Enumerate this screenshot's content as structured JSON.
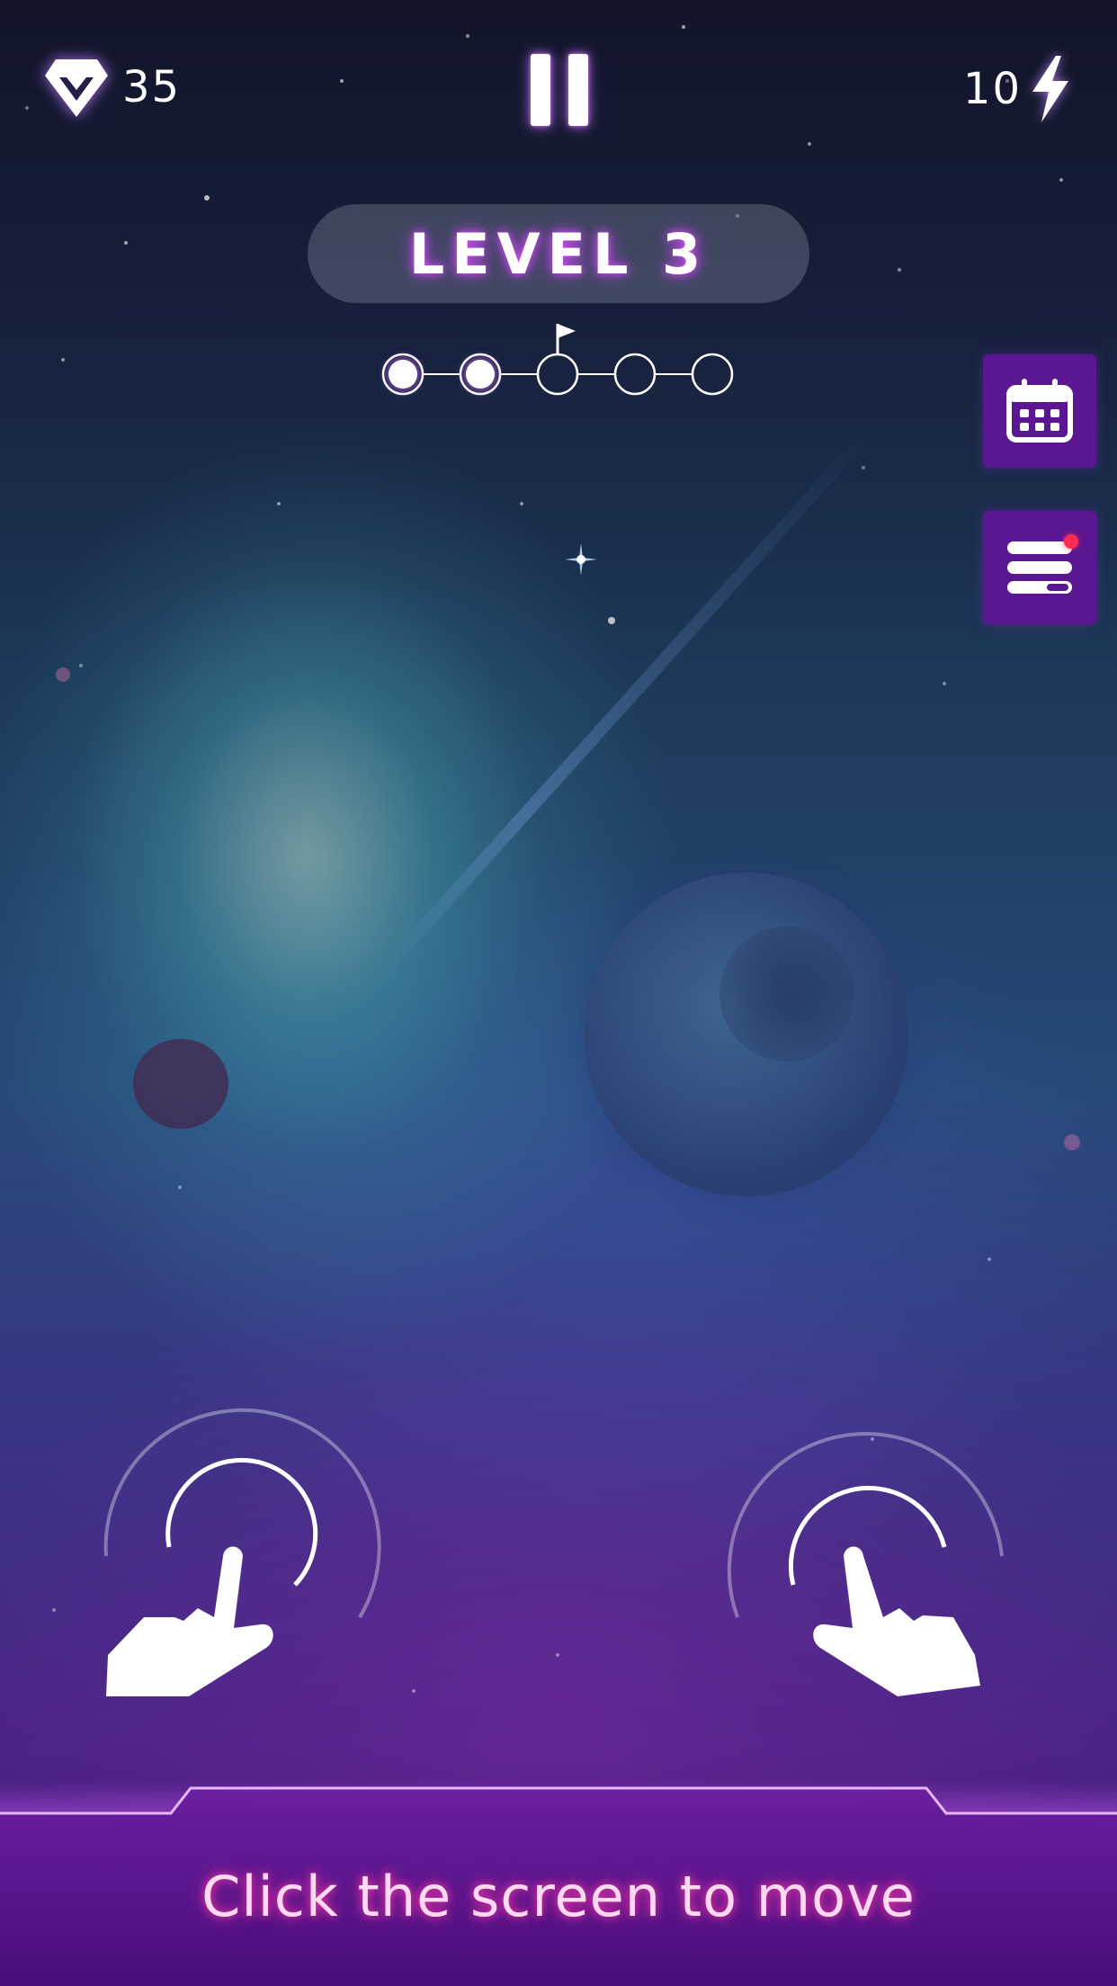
{
  "hud": {
    "gem_icon": "diamond-icon",
    "gem_count": "35",
    "pause_icon": "pause-icon",
    "energy_count": "10",
    "energy_icon": "lightning-icon"
  },
  "level": {
    "label": "LEVEL 3"
  },
  "progress": {
    "total_stages": 5,
    "completed_stages": 2,
    "flag_stage": 3,
    "flag_icon": "flag-icon"
  },
  "side_buttons": [
    {
      "icon": "calendar-icon"
    },
    {
      "icon": "menu-icon",
      "has_notification": true
    }
  ],
  "tap_hints": [
    {
      "icon": "tap-hand-icon"
    },
    {
      "icon": "tap-hand-icon"
    }
  ],
  "footer": {
    "instruction": "Click the screen to move"
  },
  "colors": {
    "accent_purple": "#5a1791",
    "glow_pink": "#ff3cab",
    "notification_red": "#ff2d55"
  }
}
